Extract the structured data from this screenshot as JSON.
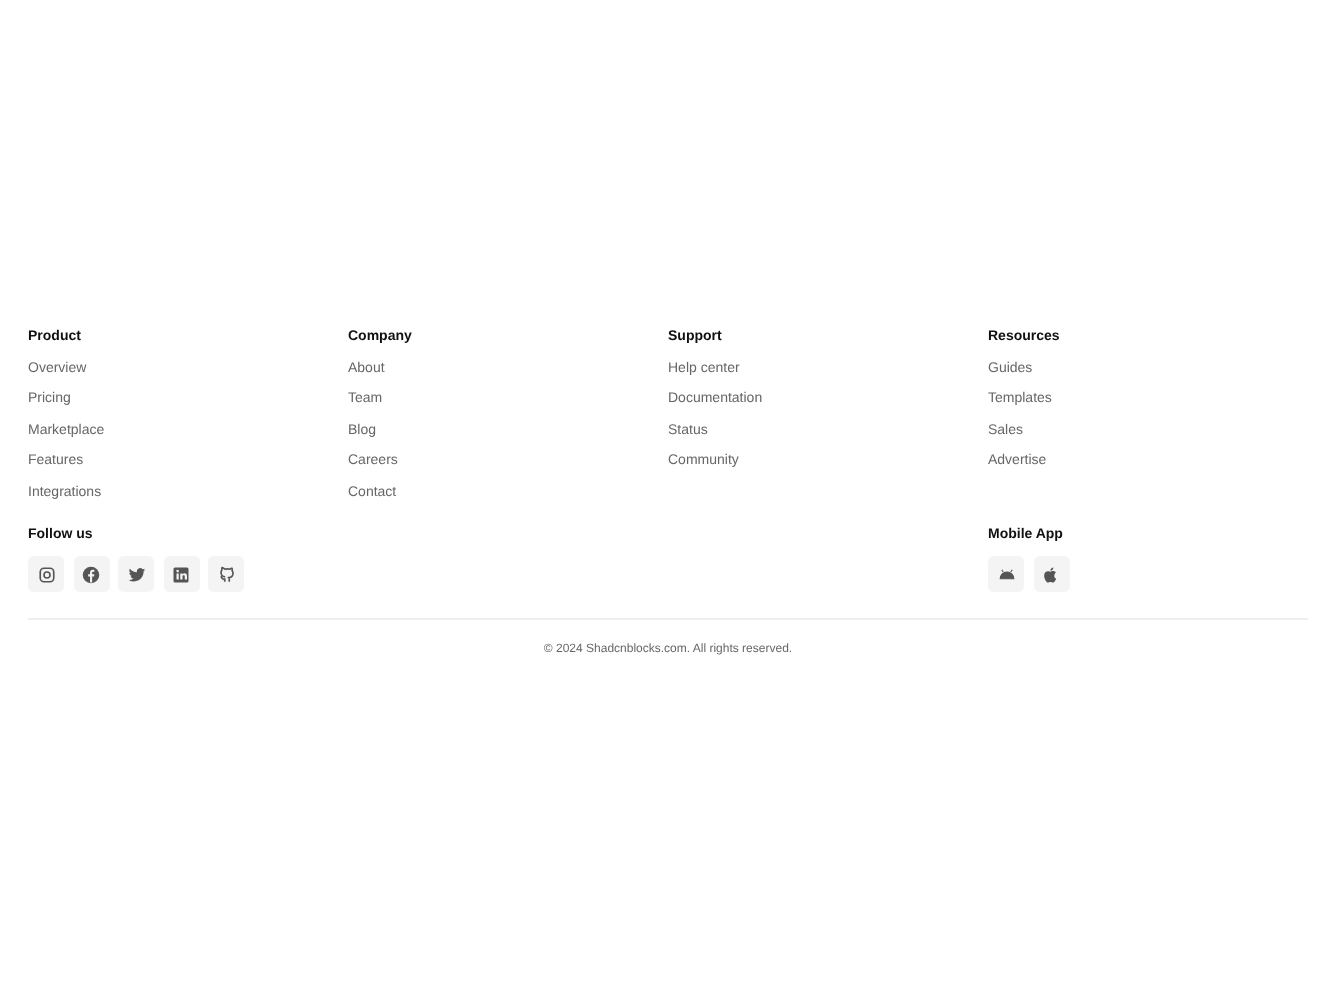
{
  "columns": [
    {
      "title": "Product",
      "links": [
        "Overview",
        "Pricing",
        "Marketplace",
        "Features",
        "Integrations"
      ]
    },
    {
      "title": "Company",
      "links": [
        "About",
        "Team",
        "Blog",
        "Careers",
        "Contact"
      ]
    },
    {
      "title": "Support",
      "links": [
        "Help center",
        "Documentation",
        "Status",
        "Community"
      ]
    },
    {
      "title": "Resources",
      "links": [
        "Guides",
        "Templates",
        "Sales",
        "Advertise"
      ]
    }
  ],
  "follow": {
    "title": "Follow us",
    "icons": [
      {
        "kind": "instagram"
      },
      {
        "kind": "facebook"
      },
      {
        "kind": "twitter"
      },
      {
        "kind": "linkedin"
      },
      {
        "kind": "github"
      }
    ]
  },
  "mobile": {
    "title": "Mobile App",
    "icons": [
      {
        "kind": "android"
      },
      {
        "kind": "apple"
      }
    ]
  },
  "copyright": "© 2024 Shadcnblocks.com. All rights reserved."
}
